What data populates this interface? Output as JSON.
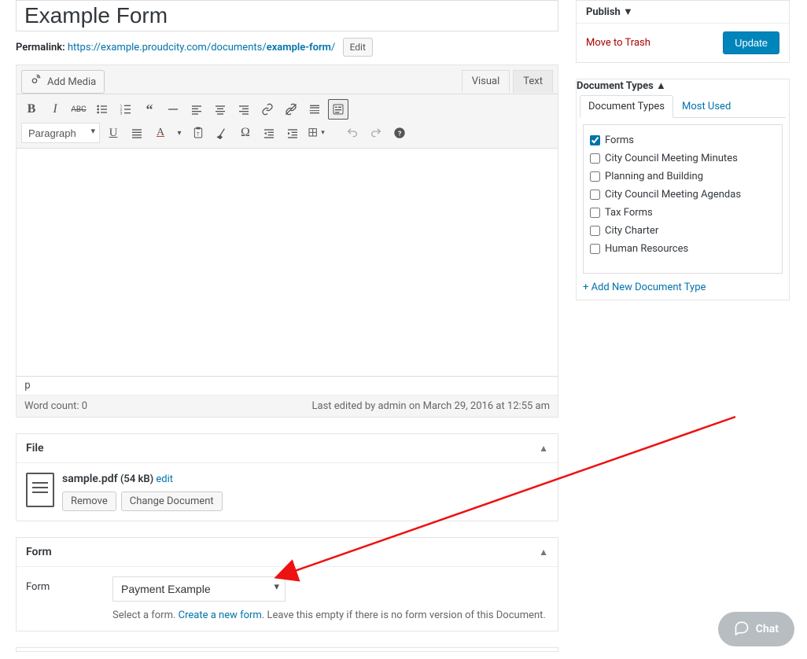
{
  "title": "Example Form",
  "permalink": {
    "label": "Permalink:",
    "base": "https://example.proudcity.com/documents/",
    "slug": "example-form",
    "suffix": "/",
    "edit": "Edit"
  },
  "media_btn": "Add Media",
  "editor_tabs": {
    "visual": "Visual",
    "text": "Text"
  },
  "format": "Paragraph",
  "status_path": "p",
  "footer": {
    "word_count": "Word count: 0",
    "last_edit": "Last edited by admin on March 29, 2016 at 12:55 am"
  },
  "file_box": {
    "title": "File",
    "name": "sample.pdf",
    "size": "(54 kB)",
    "edit": "edit",
    "remove": "Remove",
    "change": "Change Document"
  },
  "form_box": {
    "title": "Form",
    "label": "Form",
    "selected": "Payment Example",
    "desc_a": "Select a form. ",
    "desc_link": "Create a new form",
    "desc_b": ". Leave this empty if there is no form version of this Document."
  },
  "publish": {
    "title": "Publish",
    "trash": "Move to Trash",
    "update": "Update"
  },
  "doc_types": {
    "title": "Document Types",
    "tab_all": "Document Types",
    "tab_used": "Most Used",
    "items": [
      {
        "label": "Forms",
        "checked": true
      },
      {
        "label": "City Council Meeting Minutes",
        "checked": false
      },
      {
        "label": "Planning and Building",
        "checked": false
      },
      {
        "label": "City Council Meeting Agendas",
        "checked": false
      },
      {
        "label": "Tax Forms",
        "checked": false
      },
      {
        "label": "City Charter",
        "checked": false
      },
      {
        "label": "Human Resources",
        "checked": false
      }
    ],
    "add_new": "+ Add New Document Type"
  },
  "chat": "Chat"
}
